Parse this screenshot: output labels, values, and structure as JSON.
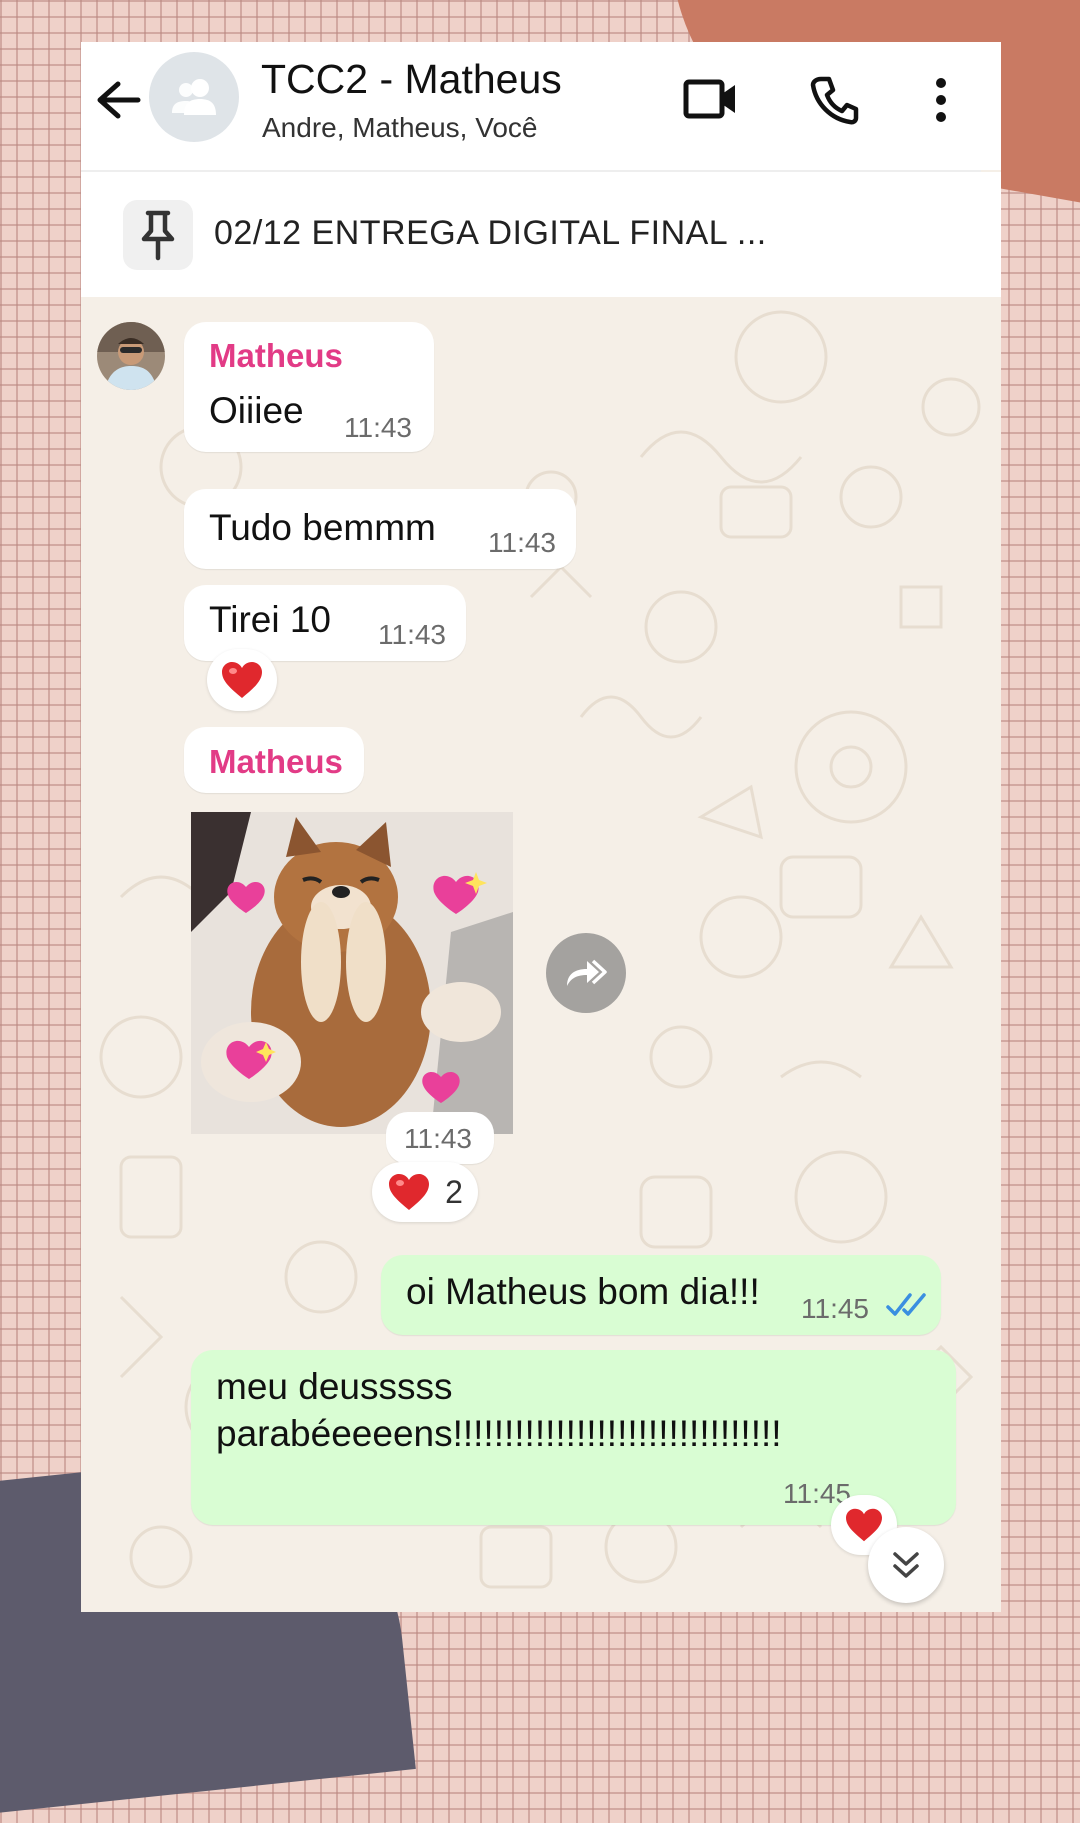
{
  "header": {
    "title": "TCC2 - Matheus",
    "participants": "Andre, Matheus, Você",
    "icons": [
      "back-arrow-icon",
      "group-avatar-icon",
      "video-call-icon",
      "voice-call-icon",
      "more-options-icon"
    ]
  },
  "pinned": {
    "text": "02/12 ENTREGA DIGITAL FINAL ...",
    "icon": "pin-icon"
  },
  "messages": {
    "m1": {
      "sender": "Matheus",
      "text": "Oiiiee",
      "time": "11:43"
    },
    "m2": {
      "text": "Tudo bemmm",
      "time": "11:43"
    },
    "m3": {
      "text": "Tirei 10",
      "time": "11:43",
      "reaction": "heart"
    },
    "m4": {
      "sender": "Matheus",
      "type": "sticker",
      "sticker": "puppy-with-hearts",
      "time": "11:43",
      "reaction_count": "2"
    },
    "m5": {
      "text": "oi Matheus bom dia!!!",
      "time": "11:45",
      "status": "read"
    },
    "m6": {
      "line1": "meu deusssss",
      "line2": "parabéeeeens!!!!!!!!!!!!!!!!!!!!!!!!!!!!!!!!",
      "time": "11:45"
    }
  },
  "colors": {
    "sender_name": "#e23b86",
    "outgoing_bubble": "#d9fdd3",
    "incoming_bubble": "#ffffff",
    "chat_background": "#f5efe7",
    "read_ticks": "#3a8fe0",
    "frame_grid": "#efd1c9"
  }
}
